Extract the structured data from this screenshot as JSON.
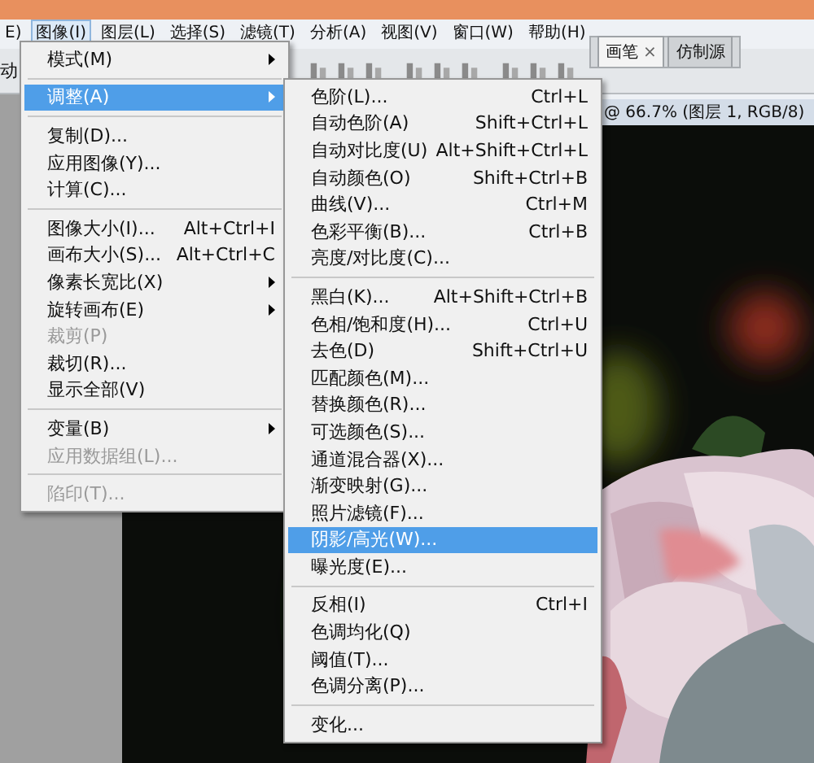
{
  "menubar": {
    "items": [
      {
        "label": "E)",
        "selected": false
      },
      {
        "label": "图像(I)",
        "selected": true
      },
      {
        "label": "图层(L)",
        "selected": false
      },
      {
        "label": "选择(S)",
        "selected": false
      },
      {
        "label": "滤镜(T)",
        "selected": false
      },
      {
        "label": "分析(A)",
        "selected": false
      },
      {
        "label": "视图(V)",
        "selected": false
      },
      {
        "label": "窗口(W)",
        "selected": false
      },
      {
        "label": "帮助(H)",
        "selected": false
      }
    ]
  },
  "options_bar": {
    "label": "动"
  },
  "panel_tabs": [
    {
      "label": "画笔",
      "close": "×",
      "selected": true
    },
    {
      "label": "仿制源",
      "selected": false
    }
  ],
  "document": {
    "title": "@ 66.7% (图层 1, RGB/8)"
  },
  "image_menu": {
    "groups": [
      [
        {
          "label": "模式(M)",
          "submenu": true,
          "disabled": false,
          "selected": false
        }
      ],
      [
        {
          "label": "调整(A)",
          "submenu": true,
          "disabled": false,
          "selected": true
        }
      ],
      [
        {
          "label": "复制(D)...",
          "submenu": false,
          "disabled": false,
          "selected": false
        },
        {
          "label": "应用图像(Y)...",
          "submenu": false,
          "disabled": false,
          "selected": false
        },
        {
          "label": "计算(C)...",
          "submenu": false,
          "disabled": false,
          "selected": false
        }
      ],
      [
        {
          "label": "图像大小(I)...",
          "shortcut": "Alt+Ctrl+I",
          "submenu": false,
          "disabled": false,
          "selected": false
        },
        {
          "label": "画布大小(S)...",
          "shortcut": "Alt+Ctrl+C",
          "submenu": false,
          "disabled": false,
          "selected": false
        },
        {
          "label": "像素长宽比(X)",
          "submenu": true,
          "disabled": false,
          "selected": false
        },
        {
          "label": "旋转画布(E)",
          "submenu": true,
          "disabled": false,
          "selected": false
        },
        {
          "label": "裁剪(P)",
          "submenu": false,
          "disabled": true,
          "selected": false
        },
        {
          "label": "裁切(R)...",
          "submenu": false,
          "disabled": false,
          "selected": false
        },
        {
          "label": "显示全部(V)",
          "submenu": false,
          "disabled": false,
          "selected": false
        }
      ],
      [
        {
          "label": "变量(B)",
          "submenu": true,
          "disabled": false,
          "selected": false
        },
        {
          "label": "应用数据组(L)...",
          "submenu": false,
          "disabled": true,
          "selected": false
        }
      ],
      [
        {
          "label": "陷印(T)...",
          "submenu": false,
          "disabled": true,
          "selected": false
        }
      ]
    ]
  },
  "adjust_menu": {
    "groups": [
      [
        {
          "label": "色阶(L)...",
          "shortcut": "Ctrl+L",
          "selected": false
        },
        {
          "label": "自动色阶(A)",
          "shortcut": "Shift+Ctrl+L",
          "selected": false
        },
        {
          "label": "自动对比度(U)",
          "shortcut": "Alt+Shift+Ctrl+L",
          "selected": false
        },
        {
          "label": "自动颜色(O)",
          "shortcut": "Shift+Ctrl+B",
          "selected": false
        },
        {
          "label": "曲线(V)...",
          "shortcut": "Ctrl+M",
          "selected": false
        },
        {
          "label": "色彩平衡(B)...",
          "shortcut": "Ctrl+B",
          "selected": false
        },
        {
          "label": "亮度/对比度(C)...",
          "selected": false
        }
      ],
      [
        {
          "label": "黑白(K)...",
          "shortcut": "Alt+Shift+Ctrl+B",
          "selected": false
        },
        {
          "label": "色相/饱和度(H)...",
          "shortcut": "Ctrl+U",
          "selected": false
        },
        {
          "label": "去色(D)",
          "shortcut": "Shift+Ctrl+U",
          "selected": false
        },
        {
          "label": "匹配颜色(M)...",
          "selected": false
        },
        {
          "label": "替换颜色(R)...",
          "selected": false
        },
        {
          "label": "可选颜色(S)...",
          "selected": false
        },
        {
          "label": "通道混合器(X)...",
          "selected": false
        },
        {
          "label": "渐变映射(G)...",
          "selected": false
        },
        {
          "label": "照片滤镜(F)...",
          "selected": false
        },
        {
          "label": "阴影/高光(W)...",
          "selected": true
        },
        {
          "label": "曝光度(E)...",
          "selected": false
        }
      ],
      [
        {
          "label": "反相(I)",
          "shortcut": "Ctrl+I",
          "selected": false
        },
        {
          "label": "色调均化(Q)",
          "selected": false
        },
        {
          "label": "阈值(T)...",
          "selected": false
        },
        {
          "label": "色调分离(P)...",
          "selected": false
        }
      ],
      [
        {
          "label": "变化...",
          "selected": false
        }
      ]
    ]
  }
}
